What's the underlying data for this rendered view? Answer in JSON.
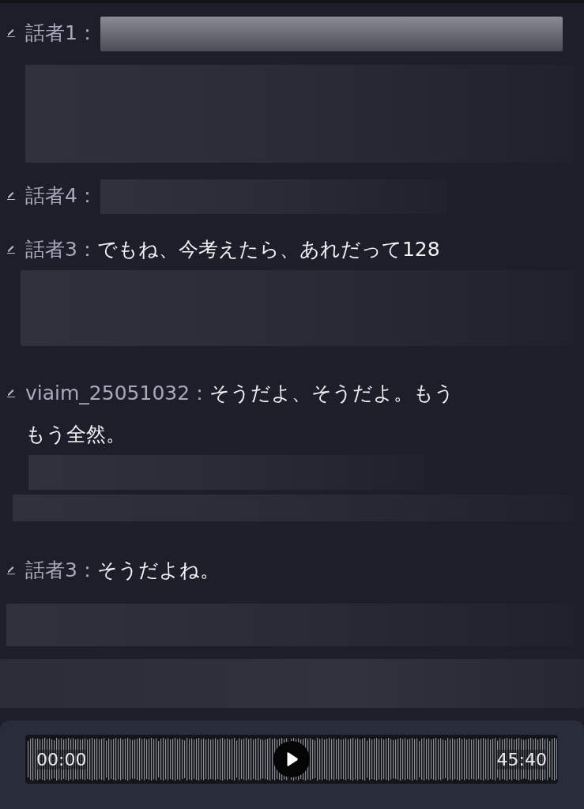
{
  "transcript": [
    {
      "speaker": "話者1："
    },
    {
      "speaker": "話者4："
    },
    {
      "speaker": "話者3：",
      "text": "でもね、今考えたら、あれだって128"
    },
    {
      "speaker": "viaim_25051032：",
      "text": "そうだよ、そうだよ。もう",
      "text_continued": "もう全然。"
    },
    {
      "speaker": "話者3：",
      "text": "そうだよね。"
    }
  ],
  "player": {
    "current_time": "00:00",
    "total_time": "45:40",
    "playing": false
  }
}
